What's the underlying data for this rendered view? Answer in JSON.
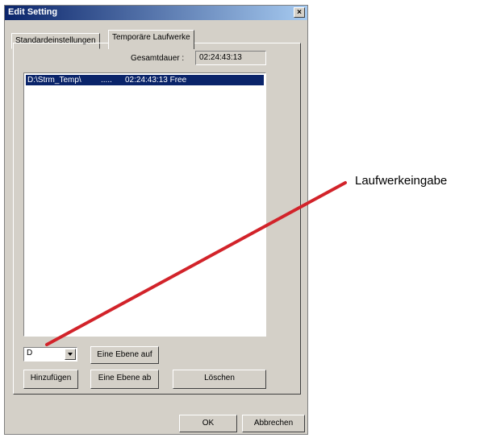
{
  "window": {
    "title": "Edit Setting",
    "close_glyph": "×"
  },
  "tabs": [
    {
      "label": "Standardeinstellungen",
      "active": false
    },
    {
      "label": "Temporäre Laufwerke",
      "active": true
    }
  ],
  "total": {
    "label": "Gesamtdauer :",
    "value": "02:24:43:13"
  },
  "drive_list": {
    "items": [
      {
        "path": "D:\\Strm_Temp\\",
        "dots": ".....",
        "time": "02:24:43:13 Free",
        "selected": true
      }
    ]
  },
  "drive_select": {
    "value": "D"
  },
  "buttons": {
    "level_up": "Eine Ebene auf",
    "add": "Hinzufügen",
    "level_down": "Eine Ebene ab",
    "delete": "Löschen",
    "ok": "OK",
    "cancel": "Abbrechen"
  },
  "annotation": {
    "label": "Laufwerkeingabe",
    "color": "#d2232a"
  },
  "colors": {
    "title_bar": "#0a246a",
    "selection": "#0a246a",
    "dialog_bg": "#d4d0c8"
  }
}
